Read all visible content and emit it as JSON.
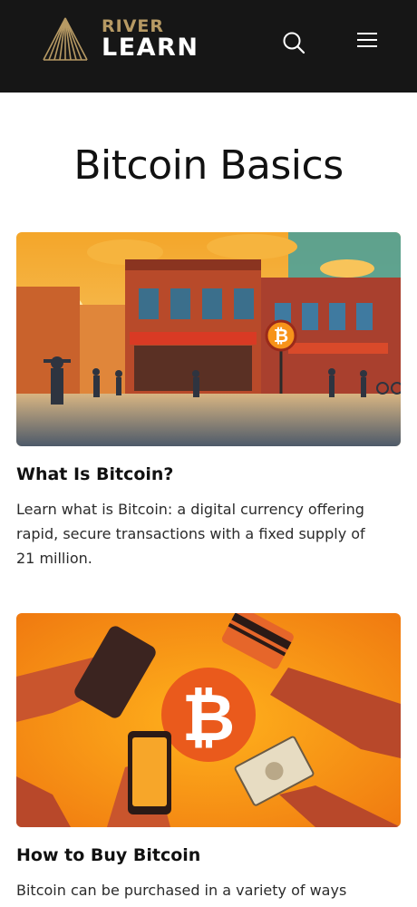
{
  "header": {
    "logo_river": "RIVER",
    "logo_learn": "LEARN",
    "search_icon": "search-icon",
    "menu_icon": "hamburger-menu-icon"
  },
  "page": {
    "title": "Bitcoin Basics"
  },
  "articles": [
    {
      "title": "What Is Bitcoin?",
      "description": "Learn what is Bitcoin: a digital currency offering rapid, secure transactions with a fixed supply of 21 million.",
      "image": "street-scene-with-bitcoin-sign-illustration"
    },
    {
      "title": "How to Buy Bitcoin",
      "description": "Bitcoin can be purchased in a variety of ways",
      "image": "hands-exchanging-cash-card-phone-bitcoin-illustration"
    }
  ],
  "colors": {
    "header_bg": "#161616",
    "brand_gold": "#b79a64",
    "bitcoin_orange": "#f7931a"
  }
}
